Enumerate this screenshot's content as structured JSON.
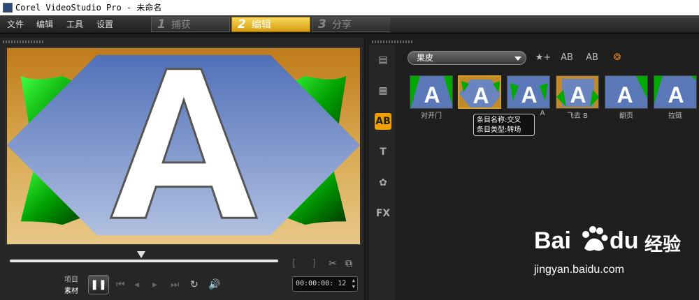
{
  "window": {
    "title": "Corel VideoStudio Pro - 未命名"
  },
  "menu": {
    "file": "文件",
    "edit": "编辑",
    "tools": "工具",
    "settings": "设置"
  },
  "steps": [
    {
      "num": "1",
      "label": "捕获"
    },
    {
      "num": "2",
      "label": "编辑"
    },
    {
      "num": "3",
      "label": "分享"
    }
  ],
  "player": {
    "mode_project": "项目",
    "mode_clip": "素材",
    "timecode": "00:00:00: 12",
    "scrub_position": 0.49
  },
  "library": {
    "category": "果皮",
    "thumbnails": [
      {
        "label": "对开门"
      },
      {
        "label": ""
      },
      {
        "label": "A"
      },
      {
        "label": "飞去 B"
      },
      {
        "label": "翻页"
      },
      {
        "label": "拉链"
      }
    ],
    "tooltip": {
      "line1": "条目名称:交叉",
      "line2": "条目类型:转场"
    }
  },
  "watermark": {
    "brand": "Bai",
    "brand2": "du",
    "cn": "经验",
    "url": "jingyan.baidu.com"
  },
  "colors": {
    "accent": "#f0a000",
    "active_step": "#e8b020",
    "preview_green": "#0aa00a",
    "preview_blue": "#7a90c8"
  }
}
